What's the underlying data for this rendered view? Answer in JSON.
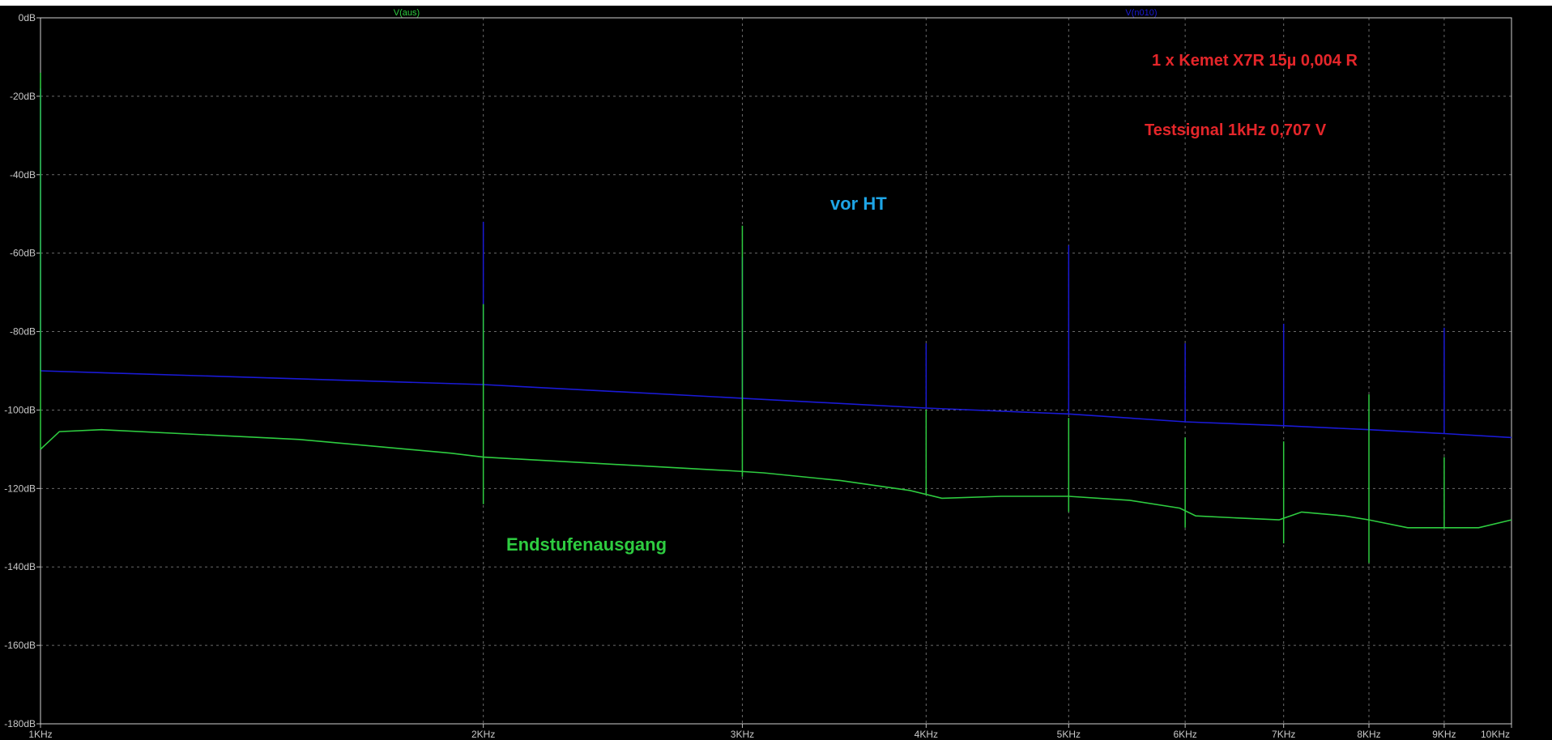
{
  "chart_data": {
    "type": "line",
    "x_scale": "log",
    "xlim": [
      1000,
      10000
    ],
    "ylim": [
      -180,
      0
    ],
    "y_unit": "dB",
    "grid": true,
    "x_ticks": [
      {
        "value": 1000,
        "label": "1KHz"
      },
      {
        "value": 2000,
        "label": "2KHz"
      },
      {
        "value": 3000,
        "label": "3KHz"
      },
      {
        "value": 4000,
        "label": "4KHz"
      },
      {
        "value": 5000,
        "label": "5KHz"
      },
      {
        "value": 6000,
        "label": "6KHz"
      },
      {
        "value": 7000,
        "label": "7KHz"
      },
      {
        "value": 8000,
        "label": "8KHz"
      },
      {
        "value": 9000,
        "label": "9KHz"
      },
      {
        "value": 10000,
        "label": "10KHz"
      }
    ],
    "y_ticks": [
      {
        "value": 0,
        "label": "0dB"
      },
      {
        "value": -20,
        "label": "-20dB"
      },
      {
        "value": -40,
        "label": "-40dB"
      },
      {
        "value": -60,
        "label": "-60dB"
      },
      {
        "value": -80,
        "label": "-80dB"
      },
      {
        "value": -100,
        "label": "-100dB"
      },
      {
        "value": -120,
        "label": "-120dB"
      },
      {
        "value": -140,
        "label": "-140dB"
      },
      {
        "value": -160,
        "label": "-160dB"
      },
      {
        "value": -180,
        "label": "-180dB"
      }
    ],
    "legend": [
      {
        "name": "V(aus)",
        "color": "#2ecc40"
      },
      {
        "name": "V(n010)",
        "color": "#1a1ad6"
      }
    ],
    "series": [
      {
        "name": "V(n010)",
        "color": "#1a1ad6",
        "baseline": [
          [
            1000,
            -90
          ],
          [
            2000,
            -93.5
          ],
          [
            3000,
            -97
          ],
          [
            4000,
            -99.5
          ],
          [
            5000,
            -101
          ],
          [
            6000,
            -103
          ],
          [
            7000,
            -104
          ],
          [
            8000,
            -105
          ],
          [
            9000,
            -106
          ],
          [
            10000,
            -107
          ]
        ],
        "peaks": [
          [
            1000,
            -18
          ],
          [
            2000,
            -52
          ],
          [
            3000,
            -61
          ],
          [
            4000,
            -83
          ],
          [
            5000,
            -58
          ],
          [
            6000,
            -83
          ],
          [
            7000,
            -78
          ],
          [
            8000,
            -103
          ],
          [
            9000,
            -79
          ]
        ]
      },
      {
        "name": "V(aus)",
        "color": "#2ecc40",
        "baseline": [
          [
            1000,
            -110
          ],
          [
            1030,
            -105.5
          ],
          [
            1100,
            -105
          ],
          [
            1500,
            -107.5
          ],
          [
            1900,
            -111
          ],
          [
            2000,
            -112
          ],
          [
            2500,
            -114
          ],
          [
            2950,
            -115.5
          ],
          [
            3100,
            -116
          ],
          [
            3500,
            -118
          ],
          [
            3900,
            -120.5
          ],
          [
            4100,
            -122.5
          ],
          [
            4500,
            -122
          ],
          [
            5000,
            -122
          ],
          [
            5500,
            -123
          ],
          [
            5950,
            -125
          ],
          [
            6100,
            -127
          ],
          [
            6500,
            -127.5
          ],
          [
            6950,
            -128
          ],
          [
            7200,
            -126
          ],
          [
            7700,
            -127
          ],
          [
            8000,
            -128
          ],
          [
            8500,
            -130
          ],
          [
            9000,
            -130
          ],
          [
            9500,
            -130
          ],
          [
            10000,
            -128
          ]
        ],
        "peaks": [
          [
            1000,
            -14
          ],
          [
            2000,
            -73
          ],
          [
            3000,
            -53
          ],
          [
            4000,
            -100
          ],
          [
            5000,
            -102
          ],
          [
            6000,
            -107
          ],
          [
            7000,
            -108
          ],
          [
            8000,
            -96
          ],
          [
            9000,
            -112
          ]
        ],
        "dips": [
          [
            2000,
            -124
          ],
          [
            3000,
            -117
          ],
          [
            5000,
            -126
          ],
          [
            6000,
            -130
          ],
          [
            7000,
            -134
          ],
          [
            8000,
            -139
          ]
        ]
      }
    ],
    "annotations": [
      {
        "text": "1 x Kemet X7R 15µ  0,004 R",
        "color": "#e5262a"
      },
      {
        "text": "Testsignal 1kHz 0,707 V",
        "color": "#e5262a"
      },
      {
        "text": "vor HT",
        "color": "#1ea5e6"
      },
      {
        "text": "Endstufenausgang",
        "color": "#2ecc40"
      }
    ]
  }
}
